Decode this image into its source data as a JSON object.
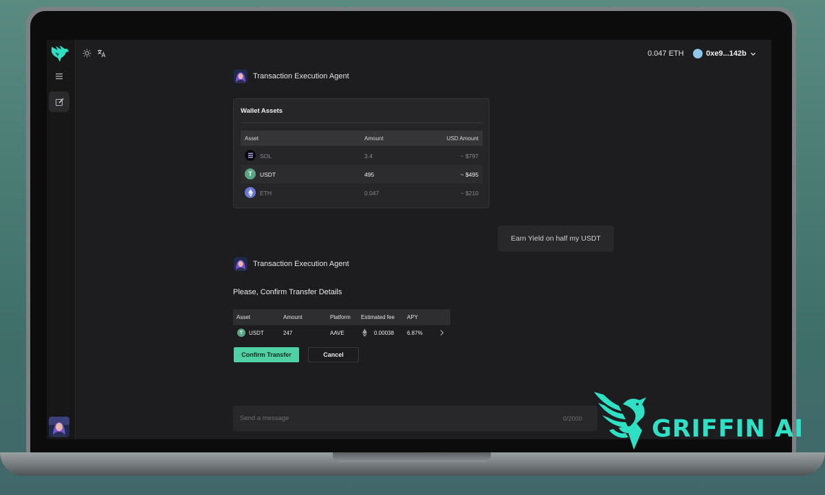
{
  "header": {
    "eth_balance": "0.047 ETH",
    "wallet_address": "0xe9...142b"
  },
  "agent": {
    "name": "Transaction Execution Agent"
  },
  "wallet_assets": {
    "title": "Wallet Assets",
    "columns": [
      "Asset",
      "Amount",
      "USD Amount"
    ],
    "rows": [
      {
        "asset": "SOL",
        "amount": "3.4",
        "usd": "~ $797"
      },
      {
        "asset": "USDT",
        "amount": "495",
        "usd": "~ $495"
      },
      {
        "asset": "ETH",
        "amount": "0.047",
        "usd": "~ $210"
      }
    ]
  },
  "user_message": "Earn Yield on half my USDT",
  "transfer": {
    "heading": "Please, Confirm Transfer Details",
    "columns": [
      "Asset",
      "Amount",
      "Platform",
      "Estimated fee",
      "APY"
    ],
    "row": {
      "asset": "USDT",
      "amount": "247",
      "platform": "AAVE",
      "fee": "0.00038",
      "apy": "6.87%"
    },
    "confirm_label": "Confirm Transfer",
    "cancel_label": "Cancel"
  },
  "composer": {
    "placeholder": "Send a message",
    "char_count": "0/2000"
  },
  "brand": {
    "name": "GRIFFIN AI"
  },
  "colors": {
    "accent": "#4fd1a5",
    "brand": "#2ee0c4",
    "background": "#1d1d1f"
  },
  "icons": [
    "griffin-logo",
    "menu-icon",
    "edit-icon",
    "sun-icon",
    "translate-icon",
    "chevron-down-icon",
    "chevron-right-icon",
    "sol-icon",
    "usdt-icon",
    "eth-icon"
  ]
}
